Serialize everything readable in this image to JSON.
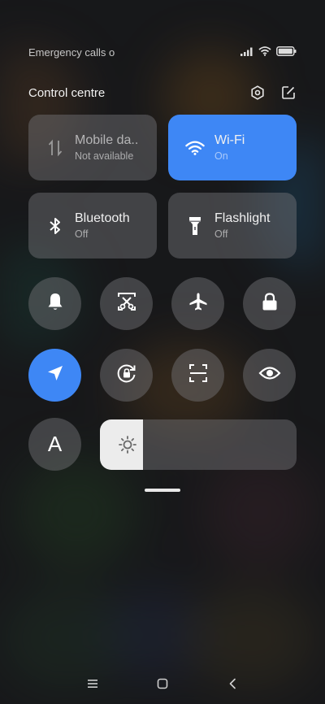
{
  "status_bar": {
    "emergency_text": "Emergency calls o",
    "icons": [
      "signal-icon",
      "wifi-icon",
      "battery-icon"
    ]
  },
  "header": {
    "title": "Control centre",
    "icons": [
      "settings-icon",
      "edit-icon"
    ]
  },
  "tiles": [
    {
      "label": "Mobile da..",
      "sub": "Not available",
      "state": "unavailable",
      "icon": "mobile-data-icon"
    },
    {
      "label": "Wi-Fi",
      "sub": "On",
      "state": "on",
      "icon": "wifi-icon"
    },
    {
      "label": "Bluetooth",
      "sub": "Off",
      "state": "off",
      "icon": "bluetooth-icon"
    },
    {
      "label": "Flashlight",
      "sub": "Off",
      "state": "off",
      "icon": "flashlight-icon"
    }
  ],
  "toggles": [
    {
      "icon": "bell-icon",
      "state": "off"
    },
    {
      "icon": "screenshot-icon",
      "state": "off"
    },
    {
      "icon": "airplane-icon",
      "state": "off"
    },
    {
      "icon": "lock-icon",
      "state": "off"
    },
    {
      "icon": "location-icon",
      "state": "on"
    },
    {
      "icon": "rotation-lock-icon",
      "state": "off"
    },
    {
      "icon": "scan-icon",
      "state": "off"
    },
    {
      "icon": "eye-icon",
      "state": "off"
    },
    {
      "icon": "auto-brightness-icon",
      "label": "A",
      "state": "off"
    }
  ],
  "brightness": {
    "level": 0.22,
    "icon": "sun-icon"
  },
  "navbar": {
    "icons": [
      "menu-icon",
      "home-icon",
      "back-icon"
    ]
  },
  "colors": {
    "accent": "#3e87f5",
    "tile_bg": "#78787d",
    "slider_fill": "#ececec"
  }
}
